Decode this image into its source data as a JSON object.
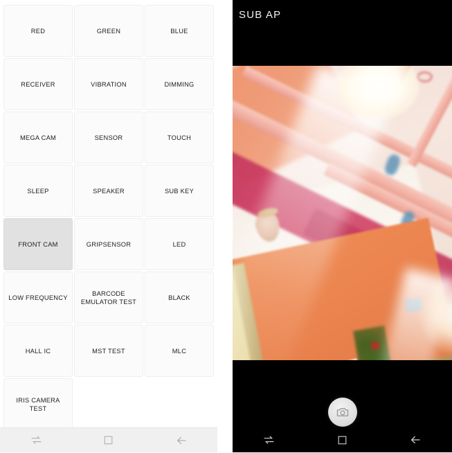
{
  "left_panel": {
    "name": "hardware-test-menu",
    "buttons": [
      {
        "label": "RED",
        "selected": false
      },
      {
        "label": "GREEN",
        "selected": false
      },
      {
        "label": "BLUE",
        "selected": false
      },
      {
        "label": "RECEIVER",
        "selected": false
      },
      {
        "label": "VIBRATION",
        "selected": false
      },
      {
        "label": "DIMMING",
        "selected": false
      },
      {
        "label": "MEGA CAM",
        "selected": false
      },
      {
        "label": "SENSOR",
        "selected": false
      },
      {
        "label": "TOUCH",
        "selected": false
      },
      {
        "label": "SLEEP",
        "selected": false
      },
      {
        "label": "SPEAKER",
        "selected": false
      },
      {
        "label": "SUB KEY",
        "selected": false
      },
      {
        "label": "FRONT CAM",
        "selected": true
      },
      {
        "label": "GRIPSENSOR",
        "selected": false
      },
      {
        "label": "LED",
        "selected": false
      },
      {
        "label": "LOW FREQUENCY",
        "selected": false
      },
      {
        "label": "BARCODE\nEMULATOR TEST",
        "selected": false
      },
      {
        "label": "BLACK",
        "selected": false
      },
      {
        "label": "HALL IC",
        "selected": false
      },
      {
        "label": "MST TEST",
        "selected": false
      },
      {
        "label": "MLC",
        "selected": false
      },
      {
        "label": "IRIS CAMERA TEST",
        "selected": false
      }
    ],
    "navbar": {
      "recents_icon": "recents-icon",
      "home_icon": "home-icon",
      "back_icon": "back-icon"
    }
  },
  "right_panel": {
    "name": "front-camera-test",
    "title": "SUB  AP",
    "preview": {
      "alt": "tilted indoor ceiling with pink wooden beams, bright lamp flare, orange wall with white framed picture and green garland"
    },
    "shutter": {
      "icon": "camera-icon",
      "label": ""
    },
    "navbar": {
      "recents_icon": "recents-icon",
      "home_icon": "home-icon",
      "back_icon": "back-icon"
    }
  },
  "colors": {
    "button_bg": "#fbfbfb",
    "button_selected_bg": "#e1e1e1",
    "button_border": "#eeeeee",
    "text": "#202020",
    "left_navbar_bg": "#f0f0f0",
    "camera_bg": "#000000",
    "camera_title_text": "#f2f2f2",
    "shutter_bg": "#dedede"
  }
}
